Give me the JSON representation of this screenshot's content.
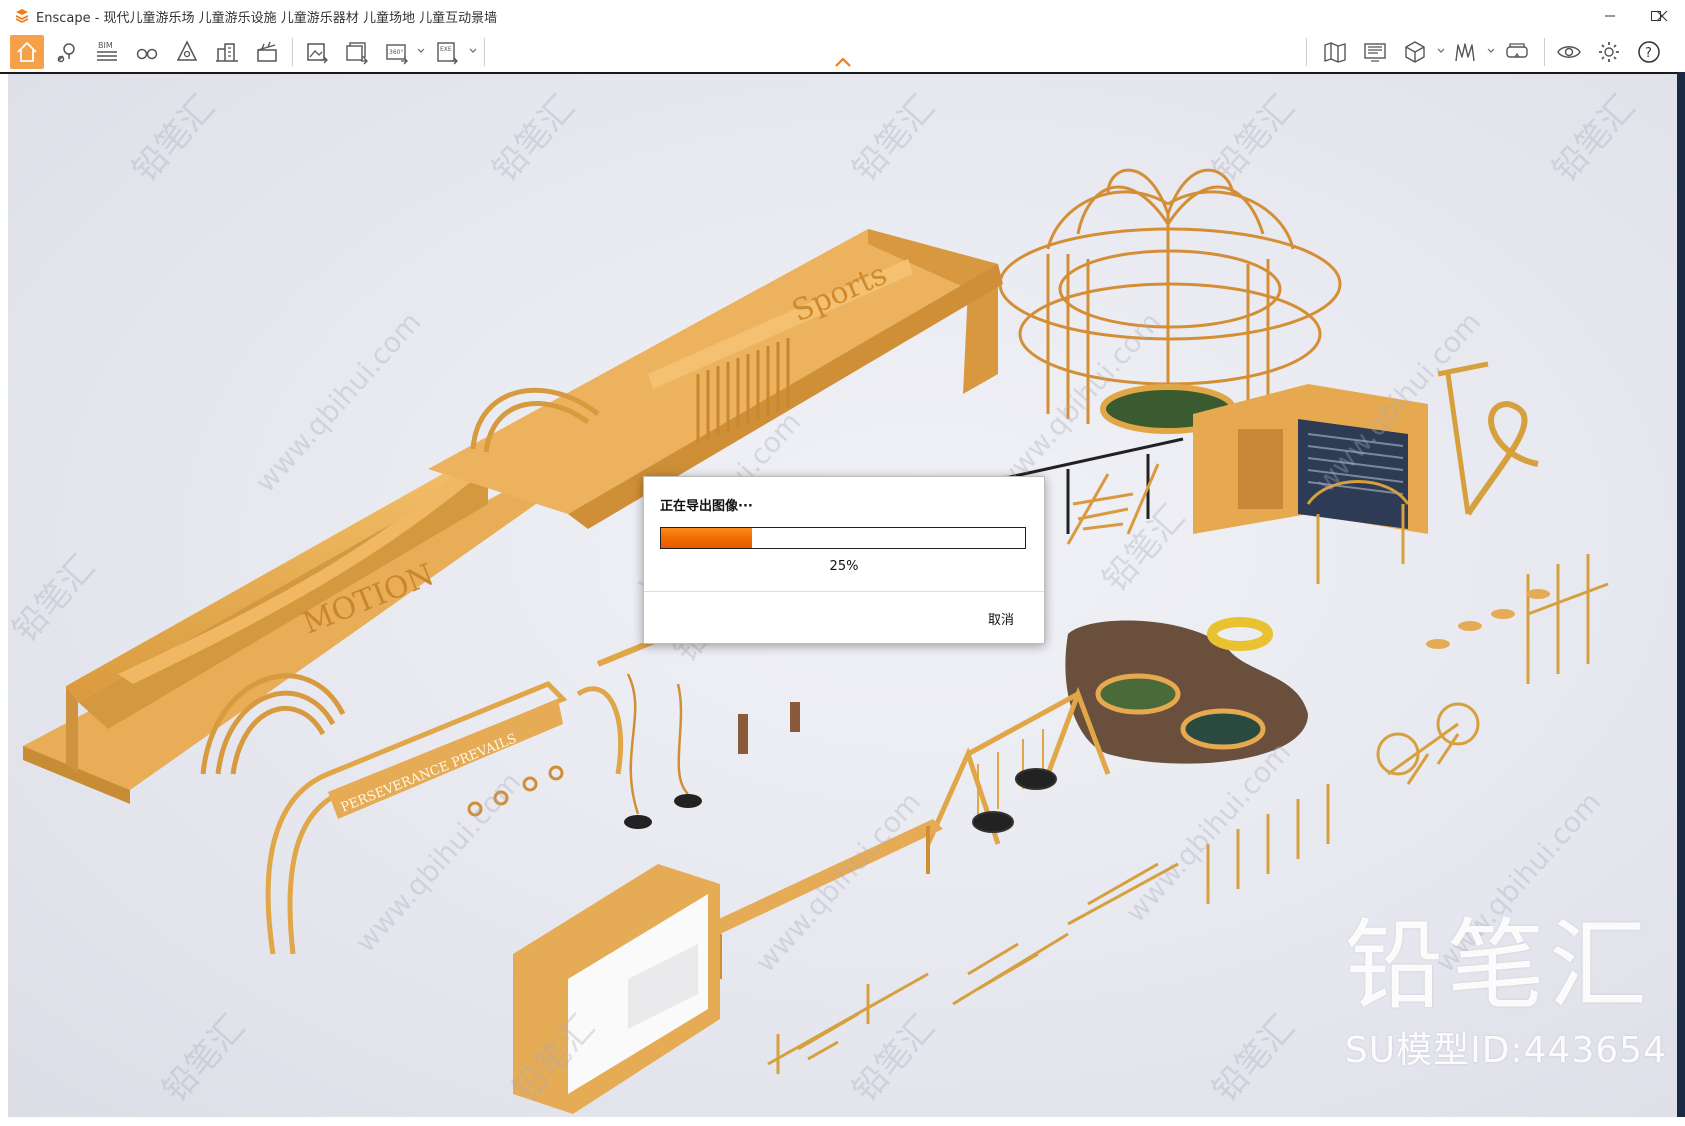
{
  "window": {
    "app_name": "Enscape",
    "title": "Enscape - 现代儿童游乐场 儿童游乐设施 儿童游乐器材 儿童场地 儿童互动景墙",
    "minimize_icon": "minimize-icon",
    "maximize_icon": "maximize-icon",
    "close_icon": "close-icon"
  },
  "toolbar": {
    "items": [
      {
        "name": "home",
        "icon": "home-icon",
        "active": true
      },
      {
        "name": "location",
        "icon": "map-pin-icon"
      },
      {
        "name": "bim",
        "label": "BIM",
        "icon": "bim-icon"
      },
      {
        "name": "views",
        "icon": "binoculars-icon"
      },
      {
        "name": "assets",
        "icon": "asset-library-icon"
      },
      {
        "name": "buildings",
        "icon": "building-icon"
      },
      {
        "name": "video",
        "icon": "clapperboard-icon"
      },
      {
        "name": "screenshot",
        "icon": "image-export-icon"
      },
      {
        "name": "batch",
        "icon": "batch-export-icon"
      },
      {
        "name": "pano",
        "label": "360°",
        "icon": "panorama-icon"
      },
      {
        "name": "exe",
        "label": "EXE",
        "icon": "exe-export-icon"
      },
      {
        "name": "map",
        "icon": "map-icon"
      },
      {
        "name": "monitor",
        "icon": "monitor-icon"
      },
      {
        "name": "cube",
        "icon": "cube-icon"
      },
      {
        "name": "lines",
        "icon": "line-chart-icon"
      },
      {
        "name": "vr",
        "icon": "vr-headset-icon"
      },
      {
        "name": "eye",
        "icon": "eye-icon"
      },
      {
        "name": "settings",
        "icon": "gear-icon"
      },
      {
        "name": "help",
        "label": "?",
        "icon": "help-icon"
      }
    ]
  },
  "dialog": {
    "title": "正在导出图像···",
    "progress": 0.25,
    "progress_text": "25%",
    "cancel_label": "取消"
  },
  "watermark": {
    "brand": "铅笔汇",
    "model_id": "SU模型ID:443654",
    "tiles": [
      "铅笔汇",
      "www.qbihui.com"
    ]
  },
  "scene": {
    "sign_sports": "Sports",
    "sign_motion": "MOTION",
    "sign_banner": "PERSEVERANCE PREVAILS"
  },
  "colors": {
    "accent": "#f5a14a",
    "gold": "#e5a94a",
    "gold_dark": "#b97a24",
    "progress": "#f06a00"
  }
}
